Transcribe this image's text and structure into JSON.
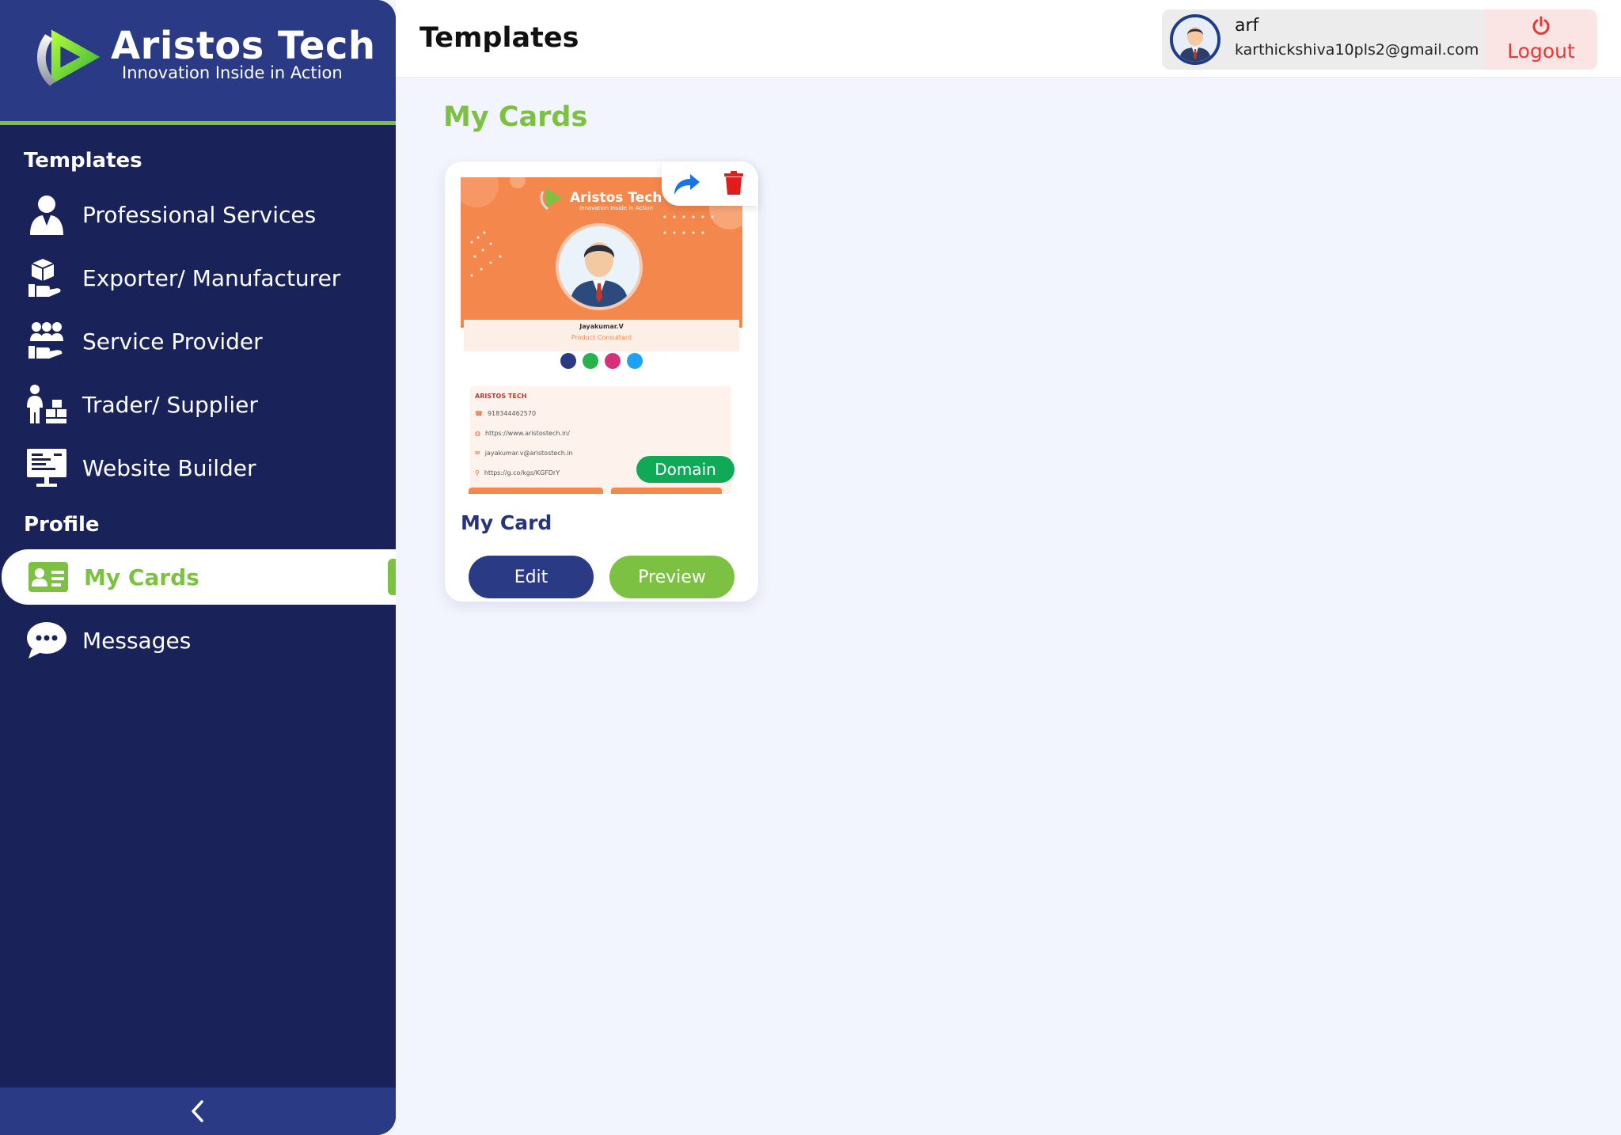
{
  "brand": {
    "name": "Aristos Tech",
    "tagline": "Innovation Inside in Action"
  },
  "sidebar": {
    "templates_title": "Templates",
    "templates_items": [
      {
        "label": "Professional Services",
        "icon": "professional-icon"
      },
      {
        "label": "Exporter/ Manufacturer",
        "icon": "exporter-icon"
      },
      {
        "label": "Service Provider",
        "icon": "service-provider-icon"
      },
      {
        "label": "Trader/ Supplier",
        "icon": "trader-icon"
      },
      {
        "label": "Website Builder",
        "icon": "website-builder-icon"
      }
    ],
    "profile_title": "Profile",
    "profile_items": [
      {
        "label": "My Cards",
        "icon": "id-card-icon",
        "active": true
      },
      {
        "label": "Messages",
        "icon": "chat-bubble-icon",
        "active": false
      }
    ],
    "collapse_icon": "chevron-left-icon"
  },
  "header": {
    "title": "Templates",
    "user": {
      "name": "arf",
      "email": "karthickshiva10pls2@gmail.com"
    },
    "logout_label": "Logout"
  },
  "main": {
    "heading": "My Cards",
    "cards": [
      {
        "name": "My Card",
        "badge": "Domain",
        "edit_label": "Edit",
        "preview_label": "Preview",
        "preview": {
          "brand_name": "Aristos Tech",
          "brand_tag": "Innovation Inside in Action",
          "person_name": "Jayakumar.V",
          "person_role": "Product Consultant",
          "company": "ARISTOS TECH",
          "phone": "918344462570",
          "website": "https://www.aristostech.in/",
          "email": "jayakumar.v@aristostech.in",
          "map": "https://g.co/kgs/KGFDrY"
        }
      }
    ]
  },
  "colors": {
    "sidebar_bg": "#19235a",
    "brand_bg": "#2b3a85",
    "accent_green": "#7cc142",
    "page_bg": "#f2f5fd",
    "logout_red": "#e53935",
    "domain_green": "#0fa958",
    "card_orange": "#f4874b"
  }
}
